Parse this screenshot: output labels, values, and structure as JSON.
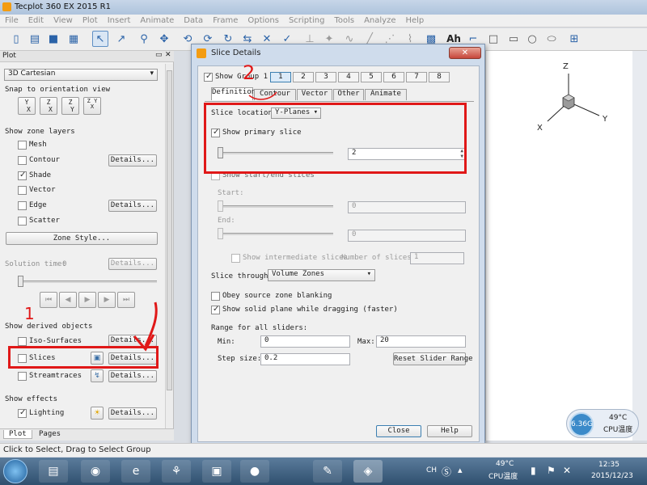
{
  "app": {
    "title": "Tecplot 360 EX 2015 R1"
  },
  "menu": [
    "File",
    "Edit",
    "View",
    "Plot",
    "Insert",
    "Animate",
    "Data",
    "Frame",
    "Options",
    "Scripting",
    "Tools",
    "Analyze",
    "Help"
  ],
  "toolbar": {
    "icons": [
      "new-icon",
      "open-icon",
      "save-icon",
      "print-icon",
      "select-arrow-icon",
      "adjust-icon",
      "zoom-icon",
      "translate-icon",
      "rotate-icon",
      "probe-icon",
      "slice-icon",
      "contour-icon",
      "text-icon",
      "rectangle-icon",
      "square-icon",
      "circle-icon",
      "ellipse-icon",
      "frame-icon"
    ],
    "text_label": "Ah"
  },
  "panel": {
    "title": "Plot",
    "plot_type": "3D Cartesian",
    "snap_label": "Snap to orientation view",
    "snap_buttons": [
      "Y X",
      "Z X",
      "Z Y",
      "Z Y X"
    ],
    "zone_layers_label": "Show zone layers",
    "layers": [
      {
        "label": "Mesh",
        "checked": false
      },
      {
        "label": "Contour",
        "checked": false,
        "details": "Details..."
      },
      {
        "label": "Shade",
        "checked": true
      },
      {
        "label": "Vector",
        "checked": false
      },
      {
        "label": "Edge",
        "checked": false,
        "details": "Details..."
      },
      {
        "label": "Scatter",
        "checked": false
      }
    ],
    "zone_style": "Zone Style...",
    "solution_time_label": "Solution time:",
    "solution_time_value": "0",
    "solution_details": "Details...",
    "derived_label": "Show derived objects",
    "derived": [
      {
        "label": "Iso-Surfaces",
        "details": "Details..."
      },
      {
        "label": "Slices",
        "details": "Details..."
      },
      {
        "label": "Streamtraces",
        "details": "Details..."
      }
    ],
    "effects_label": "Show effects",
    "effects": [
      {
        "label": "Lighting",
        "checked": true,
        "details": "Details..."
      }
    ],
    "tabs": [
      "Plot",
      "Pages"
    ]
  },
  "dialog": {
    "title": "Slice Details",
    "show_group_label": "Show Group 1",
    "groups": [
      "1",
      "2",
      "3",
      "4",
      "5",
      "6",
      "7",
      "8"
    ],
    "tabs": [
      "Definition",
      "Contour",
      "Vector",
      "Other",
      "Animate"
    ],
    "slice_location_label": "Slice location:",
    "slice_location_value": "Y-Planes",
    "show_primary_label": "Show primary slice",
    "primary_value": "2",
    "show_startend_label": "Show start/end slices",
    "start_label": "Start:",
    "start_value": "0",
    "end_label": "End:",
    "end_value": "0",
    "intermediate_label": "Show intermediate slices",
    "num_slices_label": "Number of slices:",
    "num_slices_value": "1",
    "slice_through_label": "Slice through:",
    "slice_through_value": "Volume Zones",
    "obey_label": "Obey source zone blanking",
    "solid_plane_label": "Show solid plane while dragging (faster)",
    "range_label": "Range for all sliders:",
    "min_label": "Min:",
    "min_value": "0",
    "max_label": "Max:",
    "max_value": "20",
    "step_label": "Step size:",
    "step_value": "0.2",
    "reset_label": "Reset Slider Range",
    "close_label": "Close",
    "help_label": "Help"
  },
  "axes": {
    "z": "Z",
    "x": "X",
    "y": "Y"
  },
  "status": {
    "text": "Click to Select, Drag to Select Group"
  },
  "widget": {
    "badge": "6.36G",
    "temp": "49°C",
    "label": "CPU温度"
  },
  "taskbar": {
    "icons": [
      "windows-start-icon",
      "explorer-icon",
      "chrome-icon",
      "ie-icon",
      "app-icon",
      "tecplot-icon",
      "orange-icon",
      "paint-icon",
      "tecplot-active-icon"
    ],
    "tray_lang": "CH",
    "tray_temp": "49°C",
    "tray_temp_label": "CPU温度",
    "time": "12:35",
    "date": "2015/12/23"
  },
  "annotations": {
    "number": "2",
    "number_small": "1"
  }
}
